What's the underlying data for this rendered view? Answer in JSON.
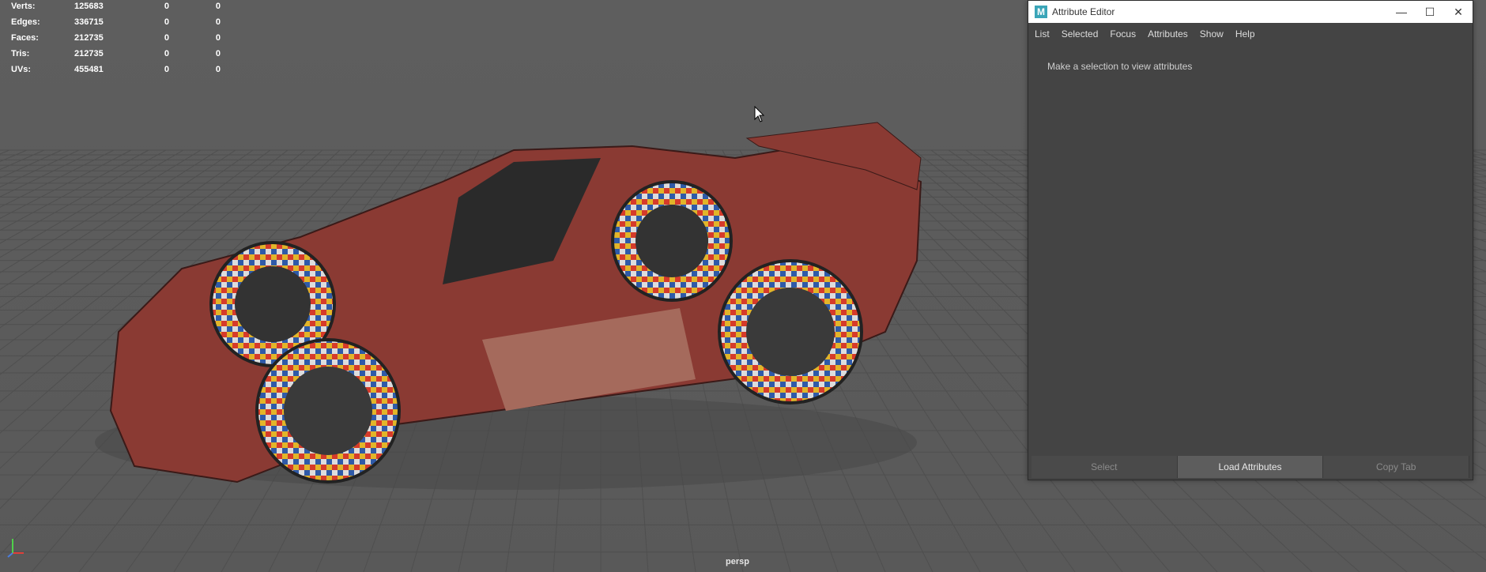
{
  "hud": {
    "rows": [
      {
        "label": "Verts:",
        "value": "125683",
        "c1": "0",
        "c2": "0"
      },
      {
        "label": "Edges:",
        "value": "336715",
        "c1": "0",
        "c2": "0"
      },
      {
        "label": "Faces:",
        "value": "212735",
        "c1": "0",
        "c2": "0"
      },
      {
        "label": "Tris:",
        "value": "212735",
        "c1": "0",
        "c2": "0"
      },
      {
        "label": "UVs:",
        "value": "455481",
        "c1": "0",
        "c2": "0"
      }
    ]
  },
  "viewport": {
    "camera": "persp"
  },
  "attribute_editor": {
    "logo": "M",
    "title": "Attribute Editor",
    "window_controls": {
      "minimize": "—",
      "maximize": "☐",
      "close": "✕"
    },
    "menu": [
      "List",
      "Selected",
      "Focus",
      "Attributes",
      "Show",
      "Help"
    ],
    "message": "Make a selection to view attributes",
    "footer": {
      "select": "Select",
      "load": "Load Attributes",
      "copy": "Copy Tab"
    }
  },
  "colors": {
    "background": "#5f5f5f",
    "grid": "#4f4f4f",
    "panel": "#444444",
    "car_body": "#8a3a33"
  }
}
